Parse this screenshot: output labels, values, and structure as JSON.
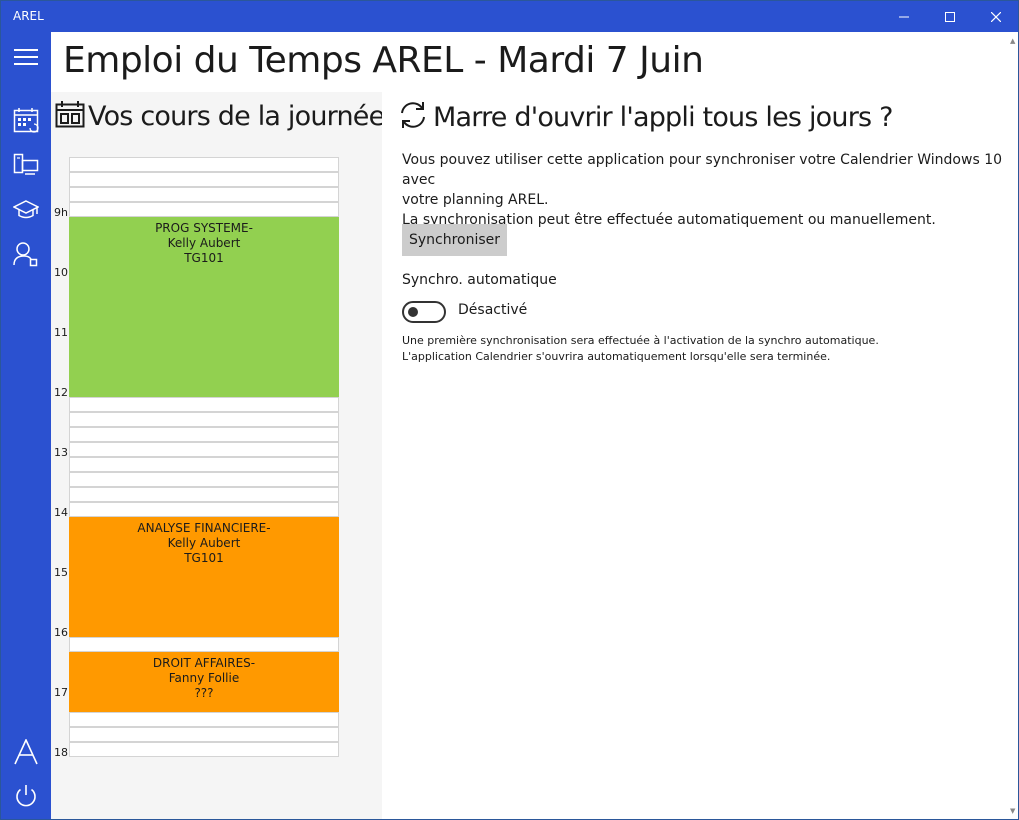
{
  "window": {
    "title": "AREL"
  },
  "header": {
    "title": "Emploi du Temps AREL - Mardi 7 Juin"
  },
  "left_panel": {
    "heading": "Vos cours de la journée ..."
  },
  "timeline": {
    "hours": [
      "9h",
      "10",
      "11",
      "12",
      "13",
      "14",
      "15",
      "16",
      "17",
      "18"
    ],
    "courses": [
      {
        "line1": "PROG SYSTEME-",
        "line2": "Kelly Aubert",
        "line3": "TG101",
        "color": "#92d050"
      },
      {
        "line1": "ANALYSE FINANCIERE-",
        "line2": "Kelly Aubert",
        "line3": "TG101",
        "color": "#ff9900"
      },
      {
        "line1": "DROIT AFFAIRES-",
        "line2": "Fanny Follie",
        "line3": "???",
        "color": "#ff9900"
      }
    ]
  },
  "right_panel": {
    "heading": "Marre d'ouvrir l'appli tous les jours ?",
    "desc_line1": "Vous pouvez utiliser cette application pour synchroniser votre Calendrier Windows 10 avec",
    "desc_line2": "votre planning AREL.",
    "desc_line3": "La synchronisation peut être effectuée automatiquement ou manuellement.",
    "sync_button": "Synchroniser",
    "auto_label": "Synchro. automatique",
    "toggle_state": "Désactivé",
    "note_line1": "Une première synchronisation sera effectuée à l'activation de la synchro automatique.",
    "note_line2": "L'application Calendrier s'ouvrira automatiquement lorsqu'elle sera terminée."
  },
  "colors": {
    "accent": "#2b51d0"
  }
}
